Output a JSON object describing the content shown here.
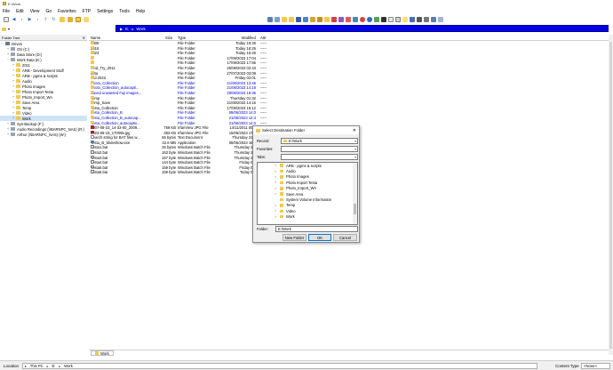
{
  "window": {
    "title": "E:\\Work"
  },
  "menu": [
    "File",
    "Edit",
    "View",
    "Go",
    "Favorites",
    "FTP",
    "Settings",
    "Tools",
    "Help"
  ],
  "address": {
    "path": [
      "E:",
      "Work"
    ]
  },
  "tree": {
    "header": "Folder Tree",
    "items": [
      {
        "label": "Drives",
        "depth": 0,
        "exp": "−",
        "kind": "drives"
      },
      {
        "label": "OS (C:)",
        "depth": 1,
        "exp": "+",
        "kind": "drive"
      },
      {
        "label": "Data Store (D:)",
        "depth": 1,
        "exp": "+",
        "kind": "drive"
      },
      {
        "label": "Work Data (E:)",
        "depth": 1,
        "exp": "−",
        "kind": "drive"
      },
      {
        "label": "2011",
        "depth": 2,
        "exp": "+",
        "kind": "folder"
      },
      {
        "label": "ARB - Development Stuff",
        "depth": 2,
        "exp": "+",
        "kind": "folder"
      },
      {
        "label": "ARB - pgms & scripts",
        "depth": 2,
        "exp": "+",
        "kind": "folder"
      },
      {
        "label": "Audio",
        "depth": 2,
        "exp": "+",
        "kind": "folder"
      },
      {
        "label": "Photo Images",
        "depth": 2,
        "exp": "+",
        "kind": "folder"
      },
      {
        "label": "Photo Import Testa",
        "depth": 2,
        "exp": "+",
        "kind": "folder"
      },
      {
        "label": "Photo_Import_WA",
        "depth": 2,
        "exp": "+",
        "kind": "folder"
      },
      {
        "label": "Save Area",
        "depth": 2,
        "exp": "+",
        "kind": "folder"
      },
      {
        "label": "Temp",
        "depth": 2,
        "exp": "+",
        "kind": "folder"
      },
      {
        "label": "Video",
        "depth": 2,
        "exp": "+",
        "kind": "folder"
      },
      {
        "label": "Work",
        "depth": 2,
        "exp": "+",
        "kind": "folder",
        "selected": true
      },
      {
        "label": "Sys-Backup (F:)",
        "depth": 1,
        "exp": "+",
        "kind": "drive"
      },
      {
        "label": "Audio Recordings (\\\\BARNPC_NAS) (R:)",
        "depth": 1,
        "exp": "+",
        "kind": "drive"
      },
      {
        "label": "Arthur (\\\\BARNPC_NAS) (W:)",
        "depth": 1,
        "exp": "+",
        "kind": "drive"
      }
    ]
  },
  "columns": {
    "name": "Name",
    "size": "Size",
    "type": "Type",
    "modified": "Modified",
    "attr": "Attr"
  },
  "files": [
    {
      "name": "2009",
      "size": "",
      "type": "File Folder",
      "modified": "Today 16:26",
      "attr": "-----",
      "kind": "folder"
    },
    {
      "name": "2019",
      "size": "",
      "type": "File Folder",
      "modified": "Today 16:26",
      "attr": "-----",
      "kind": "folder"
    },
    {
      "name": "2023",
      "size": "",
      "type": "File Folder",
      "modified": "Today 16:26",
      "attr": "-----",
      "kind": "folder"
    },
    {
      "name": "A",
      "size": "",
      "type": "File Folder",
      "modified": "17/09/2023 17:04",
      "attr": "-----",
      "kind": "folder"
    },
    {
      "name": "B",
      "size": "",
      "type": "File Folder",
      "modified": "17/09/2023 17:55",
      "attr": "-----",
      "kind": "folder"
    },
    {
      "name": "Find_Try_2011",
      "size": "",
      "type": "File Folder",
      "modified": "25/08/2023 02:43",
      "attr": "-----",
      "kind": "folder"
    },
    {
      "name": "M4a",
      "size": "",
      "type": "File Folder",
      "modified": "27/07/2023 03:09",
      "attr": "-----",
      "kind": "folder"
    },
    {
      "name": "Old 2023",
      "size": "",
      "type": "File Folder",
      "modified": "Friday 02:01",
      "attr": "-----",
      "kind": "folder"
    },
    {
      "name": "Photo_Collection",
      "size": "",
      "type": "File Folder",
      "modified": "21/06/2023 13:46",
      "attr": "-----",
      "kind": "folder",
      "blue": true
    },
    {
      "name": "Photo_Collection_autocapti...",
      "size": "",
      "type": "File Folder",
      "modified": "21/06/2023 14:18",
      "attr": "-----",
      "kind": "folder",
      "blue": true
    },
    {
      "name": "Saved unwanted Fuji images...",
      "size": "",
      "type": "File Folder",
      "modified": "29/08/2023 19:36",
      "attr": "-----",
      "kind": "folder",
      "blue": true
    },
    {
      "name": "Temp",
      "size": "",
      "type": "File Folder",
      "modified": "Thursday 01:32",
      "attr": "-----",
      "kind": "folder"
    },
    {
      "name": "Temp_Save",
      "size": "",
      "type": "File Folder",
      "modified": "21/08/2023 14:15",
      "attr": "-----",
      "kind": "folder"
    },
    {
      "name": "Testa_Collection",
      "size": "",
      "type": "File Folder",
      "modified": "17/09/2023 16:12",
      "attr": "-----",
      "kind": "folder"
    },
    {
      "name": "Testa_Collection_B",
      "size": "",
      "type": "File Folder",
      "modified": "08/06/2023 14:0",
      "attr": "-----",
      "kind": "folder",
      "blue": true
    },
    {
      "name": "Testa_Collection_B_autocap...",
      "size": "",
      "type": "File Folder",
      "modified": "21/06/2023 14:4",
      "attr": "-----",
      "kind": "folder",
      "blue": true
    },
    {
      "name": "Testa_Collection_autocaptio...",
      "size": "",
      "type": "File Folder",
      "modified": "21/06/2023 14:0",
      "attr": "-----",
      "kind": "folder",
      "blue": true
    },
    {
      "name": "2007-08-23_14-33-00_2009...",
      "size": "759 KB",
      "type": "IrfanView JPG File",
      "modified": "14/11/2011 00:0",
      "attr": "-----",
      "kind": "jpg"
    },
    {
      "name": "2023-06-15_170055.jpg",
      "size": "383 KB",
      "type": "IrfanView JPG File",
      "modified": "15/06/2023 17:0",
      "attr": "-----",
      "kind": "jpg"
    },
    {
      "name": "Search string for BAT files w...",
      "size": "65 bytes",
      "type": "Text Document",
      "modified": "Thursday 21:3",
      "attr": "-----",
      "kind": "txt"
    },
    {
      "name": "Testa_B_Slideshow.exe",
      "size": "22.8 MB",
      "type": "Application",
      "modified": "08/06/2023 19:4",
      "attr": "-----",
      "kind": "exe"
    },
    {
      "name": "Testa1.bat",
      "size": "25 bytes",
      "type": "Windows Batch File",
      "modified": "Thursday 20:",
      "attr": "-----",
      "kind": "bat"
    },
    {
      "name": "Testa2.bat",
      "size": "163 bytes",
      "type": "Windows Batch File",
      "modified": "Thursday 21:",
      "attr": "-----",
      "kind": "bat"
    },
    {
      "name": "Testa3.bat",
      "size": "157 bytes",
      "type": "Windows Batch File",
      "modified": "Thursday 21:",
      "attr": "-----",
      "kind": "bat"
    },
    {
      "name": "Testa4.bat",
      "size": "144 bytes",
      "type": "Windows Batch File",
      "modified": "Friday 01:",
      "attr": "-----",
      "kind": "bat"
    },
    {
      "name": "Testa5.bat",
      "size": "159 bytes",
      "type": "Windows Batch File",
      "modified": "Friday 02:",
      "attr": "-----",
      "kind": "bat"
    },
    {
      "name": "Testa6.bat",
      "size": "159 bytes",
      "type": "Windows Batch File",
      "modified": "Today 01:",
      "attr": "-----",
      "kind": "bat"
    }
  ],
  "dialog": {
    "title": "Select Destination Folder",
    "close": "✕",
    "recent_label": "Recent:",
    "recent_value": "E:\\Work",
    "favorites_label": "Favorites:",
    "favorites_value": "",
    "tabs_label": "Tabs:",
    "tabs_value": "",
    "tree": [
      {
        "label": "ARB - pgms & scripts",
        "exp": ">"
      },
      {
        "label": "Audio",
        "exp": ">"
      },
      {
        "label": "Photo Images",
        "exp": ">"
      },
      {
        "label": "Photo Import Testa",
        "exp": ">"
      },
      {
        "label": "Photo_Import_WA",
        "exp": ">"
      },
      {
        "label": "Save Area",
        "exp": ">"
      },
      {
        "label": "System Volume Information",
        "exp": ""
      },
      {
        "label": "Temp",
        "exp": ">"
      },
      {
        "label": "Video",
        "exp": ">"
      },
      {
        "label": "Work",
        "exp": ">"
      }
    ],
    "folder_label": "Folder:",
    "folder_value": "E:\\Work",
    "new_folder": "New Folder",
    "ok": "OK",
    "cancel": "Cancel"
  },
  "bottom_tab": "Work",
  "status": {
    "location_label": "Location",
    "crumbs": [
      "This PC",
      "E:",
      "Work"
    ],
    "content_type_label": "Content Type",
    "content_type_value": "<None>"
  }
}
